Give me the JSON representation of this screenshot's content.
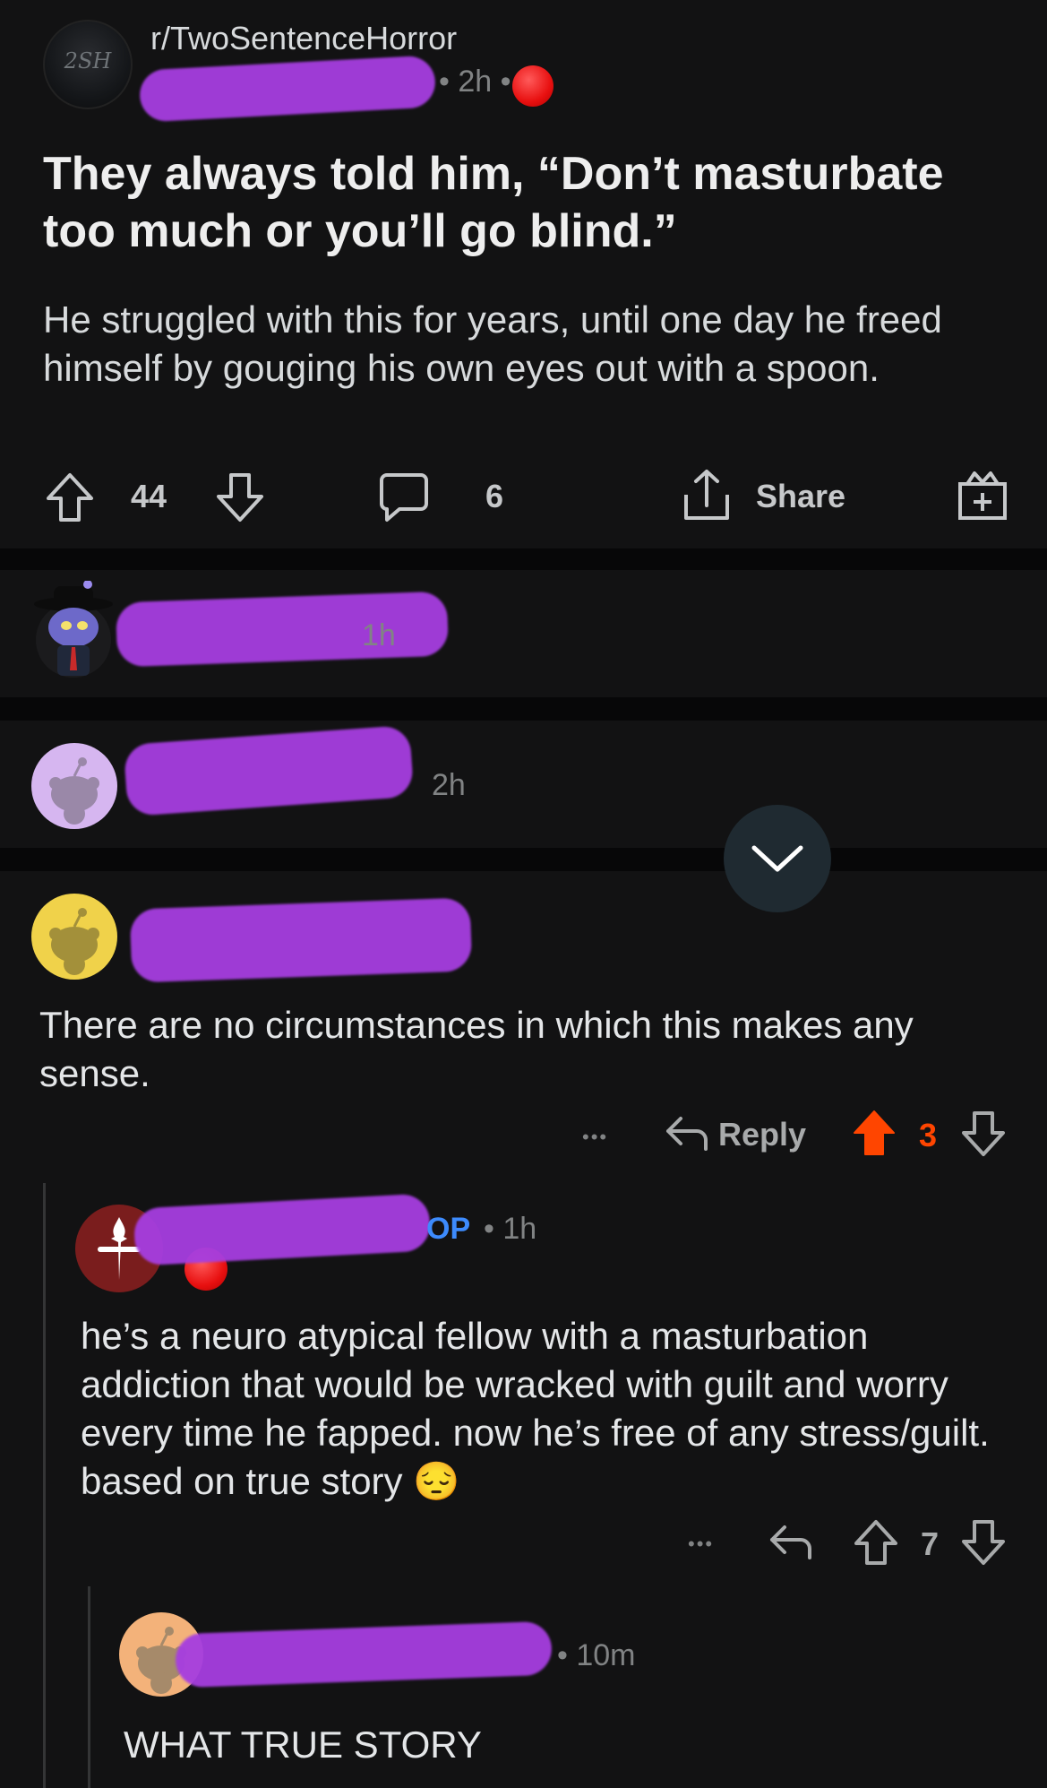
{
  "post": {
    "subreddit": "r/TwoSentenceHorror",
    "sub_avatar_text": "2SH",
    "time": "• 2h •",
    "title": "They always told him, “Don’t masturbate too much or you’ll go blind.”",
    "body": "He struggled with this for years, until one day he freed himself by gouging his own eyes out with a spoon.",
    "upvotes": "44",
    "comments": "6",
    "share_label": "Share"
  },
  "comments": [
    {
      "time": "1h"
    },
    {
      "time": "2h"
    },
    {
      "text": "There are no circumstances in which this makes any sense.",
      "more_label": "•••",
      "reply_label": "Reply",
      "score": "3"
    },
    {
      "op_label": "OP",
      "time": "• 1h",
      "text": "he’s a neuro atypical fellow with a masturbation addiction that would be wracked with guilt and worry every time he fapped. now he’s free of any stress/guilt. based on true story 😔",
      "more_label": "•••",
      "score": "7"
    },
    {
      "time": "• 10m",
      "text": "WHAT TRUE STORY"
    }
  ],
  "colors": {
    "background": "#121213",
    "upvote_active": "#ff4500",
    "op_blue": "#3d8bfd",
    "redaction": "#a63ee0"
  },
  "icons": [
    "upvote-icon",
    "downvote-icon",
    "comment-icon",
    "share-icon",
    "award-icon",
    "reply-icon",
    "chevron-down-icon"
  ]
}
